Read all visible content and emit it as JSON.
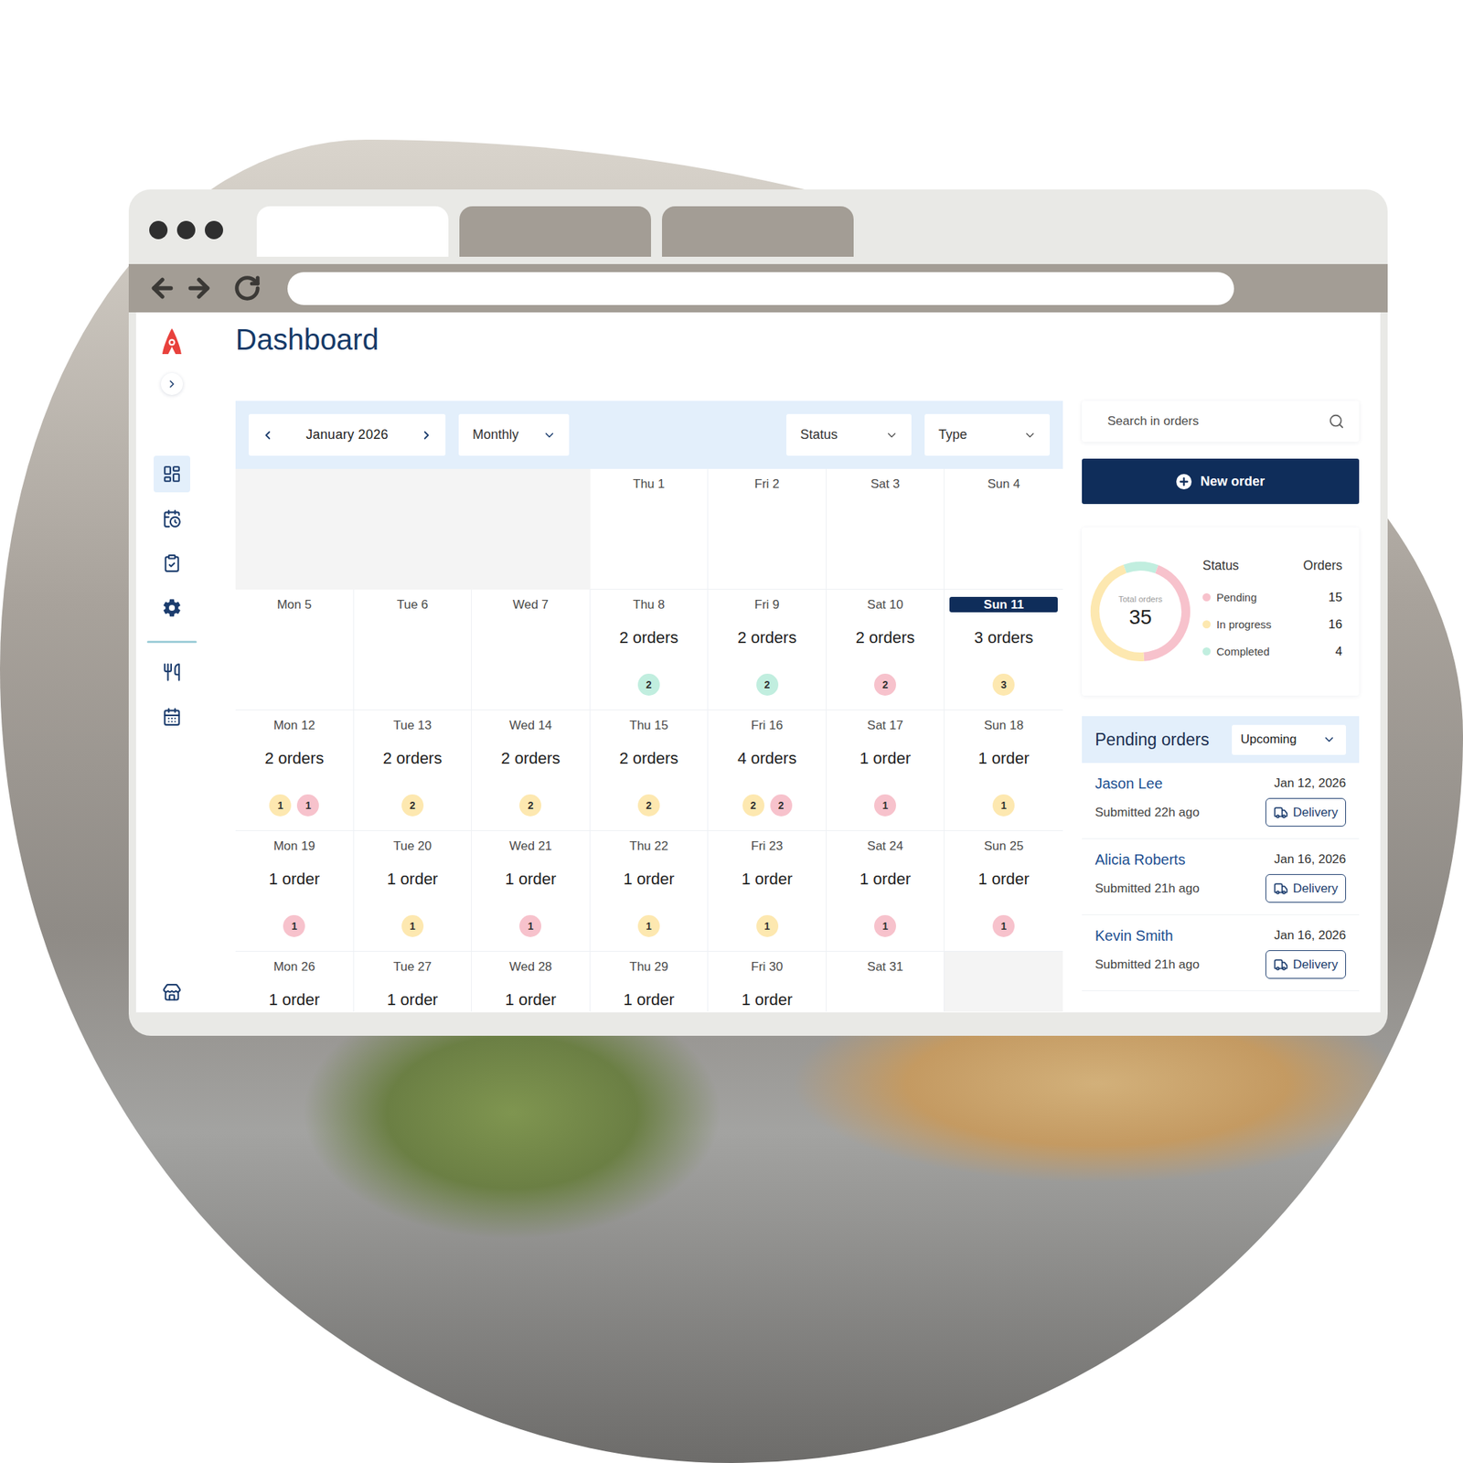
{
  "page": {
    "title": "Dashboard"
  },
  "browser": {
    "tabs": [
      {
        "selected": true
      },
      {
        "selected": false
      },
      {
        "selected": false
      }
    ]
  },
  "sidebar": {
    "expanded": false,
    "items": [
      {
        "selected": true
      },
      {
        "selected": false
      },
      {
        "selected": false
      },
      {
        "selected": false
      }
    ],
    "secondary": [
      {
        "selected": false
      },
      {
        "selected": false
      }
    ],
    "footer": [
      {
        "selected": false
      }
    ]
  },
  "calendar": {
    "month": "January 2026",
    "view": "Monthly",
    "filters": [
      "Status",
      "Type"
    ],
    "weeks": [
      [
        {
          "kind": "empty",
          "selected": false
        },
        {
          "kind": "empty",
          "selected": false
        },
        {
          "kind": "empty",
          "selected": false
        },
        {
          "kind": "day",
          "label": "Thu 1",
          "selected": false,
          "badges": []
        },
        {
          "kind": "day",
          "label": "Fri 2",
          "selected": false,
          "badges": []
        },
        {
          "kind": "day",
          "label": "Sat 3",
          "selected": false,
          "badges": []
        },
        {
          "kind": "day",
          "label": "Sun 4",
          "selected": false,
          "badges": []
        }
      ],
      [
        {
          "kind": "day",
          "label": "Mon 5",
          "selected": false,
          "badges": []
        },
        {
          "kind": "day",
          "label": "Tue 6",
          "selected": false,
          "badges": []
        },
        {
          "kind": "day",
          "label": "Wed 7",
          "selected": false,
          "badges": []
        },
        {
          "kind": "day",
          "label": "Thu 8",
          "orders": "2 orders",
          "selected": false,
          "badges": [
            {
              "count": "2",
              "color": "#c1eedf"
            }
          ]
        },
        {
          "kind": "day",
          "label": "Fri 9",
          "orders": "2 orders",
          "selected": false,
          "badges": [
            {
              "count": "2",
              "color": "#c1eedf"
            }
          ]
        },
        {
          "kind": "day",
          "label": "Sat 10",
          "orders": "2 orders",
          "selected": false,
          "badges": [
            {
              "count": "2",
              "color": "#f7c2cc"
            }
          ]
        },
        {
          "kind": "day",
          "label": "Sun 11",
          "orders": "3 orders",
          "selected": true,
          "badges": [
            {
              "count": "3",
              "color": "#fde8b0"
            }
          ]
        }
      ],
      [
        {
          "kind": "day",
          "label": "Mon 12",
          "orders": "2 orders",
          "selected": false,
          "badges": [
            {
              "count": "1",
              "color": "#fde8b0"
            },
            {
              "count": "1",
              "color": "#f7c2cc"
            }
          ]
        },
        {
          "kind": "day",
          "label": "Tue 13",
          "orders": "2 orders",
          "selected": false,
          "badges": [
            {
              "count": "2",
              "color": "#fde8b0"
            }
          ]
        },
        {
          "kind": "day",
          "label": "Wed 14",
          "orders": "2 orders",
          "selected": false,
          "badges": [
            {
              "count": "2",
              "color": "#fde8b0"
            }
          ]
        },
        {
          "kind": "day",
          "label": "Thu 15",
          "orders": "2 orders",
          "selected": false,
          "badges": [
            {
              "count": "2",
              "color": "#fde8b0"
            }
          ]
        },
        {
          "kind": "day",
          "label": "Fri 16",
          "orders": "4 orders",
          "selected": false,
          "badges": [
            {
              "count": "2",
              "color": "#fde8b0"
            },
            {
              "count": "2",
              "color": "#f7c2cc"
            }
          ]
        },
        {
          "kind": "day",
          "label": "Sat 17",
          "orders": "1 order",
          "selected": false,
          "badges": [
            {
              "count": "1",
              "color": "#f7c2cc"
            }
          ]
        },
        {
          "kind": "day",
          "label": "Sun 18",
          "orders": "1 order",
          "selected": false,
          "badges": [
            {
              "count": "1",
              "color": "#fde8b0"
            }
          ]
        }
      ],
      [
        {
          "kind": "day",
          "label": "Mon 19",
          "orders": "1 order",
          "selected": false,
          "badges": [
            {
              "count": "1",
              "color": "#f7c2cc"
            }
          ]
        },
        {
          "kind": "day",
          "label": "Tue 20",
          "orders": "1 order",
          "selected": false,
          "badges": [
            {
              "count": "1",
              "color": "#fde8b0"
            }
          ]
        },
        {
          "kind": "day",
          "label": "Wed 21",
          "orders": "1 order",
          "selected": false,
          "badges": [
            {
              "count": "1",
              "color": "#f7c2cc"
            }
          ]
        },
        {
          "kind": "day",
          "label": "Thu 22",
          "orders": "1 order",
          "selected": false,
          "badges": [
            {
              "count": "1",
              "color": "#fde8b0"
            }
          ]
        },
        {
          "kind": "day",
          "label": "Fri 23",
          "orders": "1 order",
          "selected": false,
          "badges": [
            {
              "count": "1",
              "color": "#fde8b0"
            }
          ]
        },
        {
          "kind": "day",
          "label": "Sat 24",
          "orders": "1 order",
          "selected": false,
          "badges": [
            {
              "count": "1",
              "color": "#f7c2cc"
            }
          ]
        },
        {
          "kind": "day",
          "label": "Sun 25",
          "orders": "1 order",
          "selected": false,
          "badges": [
            {
              "count": "1",
              "color": "#f7c2cc"
            }
          ]
        }
      ],
      [
        {
          "kind": "day",
          "label": "Mon 26",
          "orders": "1 order",
          "selected": false,
          "badges": []
        },
        {
          "kind": "day",
          "label": "Tue 27",
          "orders": "1 order",
          "selected": false,
          "badges": []
        },
        {
          "kind": "day",
          "label": "Wed 28",
          "orders": "1 order",
          "selected": false,
          "badges": []
        },
        {
          "kind": "day",
          "label": "Thu 29",
          "orders": "1 order",
          "selected": false,
          "badges": []
        },
        {
          "kind": "day",
          "label": "Fri 30",
          "orders": "1 order",
          "selected": false,
          "badges": []
        },
        {
          "kind": "day",
          "label": "Sat 31",
          "selected": false,
          "badges": []
        },
        {
          "kind": "empty",
          "selected": false
        }
      ]
    ]
  },
  "search": {
    "placeholder": "Search in orders"
  },
  "new_order": {
    "label": "New order"
  },
  "summary": {
    "total_label": "Total orders",
    "total": "35",
    "columns": [
      "Status",
      "Orders"
    ],
    "statuses": [
      {
        "label": "Pending",
        "orders": "15",
        "value": 15,
        "color": "#f7c2cc"
      },
      {
        "label": "In progress",
        "orders": "16",
        "value": 16,
        "color": "#fde8b0"
      },
      {
        "label": "Completed",
        "orders": "4",
        "value": 4,
        "color": "#c1eedf"
      }
    ]
  },
  "pending_orders": {
    "title": "Pending orders",
    "filter": "Upcoming",
    "orders": [
      {
        "name": "Jason Lee",
        "date": "Jan 12, 2026",
        "submitted": "Submitted 22h ago",
        "type": "Delivery"
      },
      {
        "name": "Alicia Roberts",
        "date": "Jan 16, 2026",
        "submitted": "Submitted 21h ago",
        "type": "Delivery"
      },
      {
        "name": "Kevin Smith",
        "date": "Jan 16, 2026",
        "submitted": "Submitted 21h ago",
        "type": "Delivery"
      }
    ]
  }
}
